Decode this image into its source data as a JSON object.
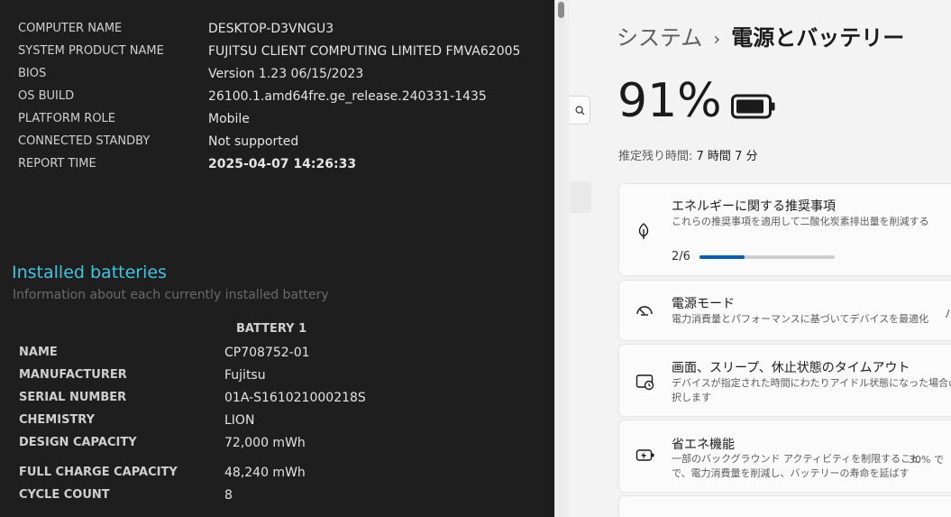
{
  "report": {
    "system_rows": [
      {
        "key": "COMPUTER NAME",
        "value": "DESKTOP-D3VNGU3"
      },
      {
        "key": "SYSTEM PRODUCT NAME",
        "value": "FUJITSU CLIENT COMPUTING LIMITED FMVA62005"
      },
      {
        "key": "BIOS",
        "value": "Version 1.23 06/15/2023"
      },
      {
        "key": "OS BUILD",
        "value": "26100.1.amd64fre.ge_release.240331-1435"
      },
      {
        "key": "PLATFORM ROLE",
        "value": "Mobile"
      },
      {
        "key": "CONNECTED STANDBY",
        "value": "Not supported"
      },
      {
        "key": "REPORT TIME",
        "value": "2025-04-07  14:26:33"
      }
    ],
    "batteries_title": "Installed batteries",
    "batteries_subtitle": "Information about each currently installed battery",
    "battery_column": "BATTERY 1",
    "battery_rows": [
      {
        "key": "NAME",
        "value": "CP708752-01"
      },
      {
        "key": "MANUFACTURER",
        "value": "Fujitsu"
      },
      {
        "key": "SERIAL NUMBER",
        "value": "01A-S161021000218S"
      },
      {
        "key": "CHEMISTRY",
        "value": "LION"
      },
      {
        "key": "DESIGN CAPACITY",
        "value": "72,000 mWh"
      },
      {
        "key": "FULL CHARGE CAPACITY",
        "value": "48,240 mWh"
      },
      {
        "key": "CYCLE COUNT",
        "value": "8"
      }
    ]
  },
  "settings": {
    "breadcrumb_parent": "システム",
    "breadcrumb_separator": "›",
    "breadcrumb_current": "電源とバッテリー",
    "battery_percent": "91%",
    "battery_level": 0.91,
    "remaining_label": "推定残り時間:",
    "remaining_value": "7 時間 7 分",
    "cards": {
      "energy": {
        "title": "エネルギーに関する推奨事項",
        "desc": "これらの推奨事項を適用して二酸化炭素排出量を削減する",
        "progress_text": "2/6",
        "progress_fraction": 0.333
      },
      "power_mode": {
        "title": "電源モード",
        "desc": "電力消費量とパフォーマンスに基づいてデバイスを最適化",
        "value_fragment": "バ"
      },
      "screen": {
        "title": "画面、スリープ、休止状態のタイムアウト",
        "desc_line1": "デバイスが指定された時間にわたりアイドル状態になった場合の動作",
        "desc_line2": "択します"
      },
      "saver": {
        "title": "省エネ機能",
        "desc_line1": "一部のバックグラウンド アクティビティを制限すること",
        "desc_line2": "で、電力消費量を削減し、バッテリーの寿命を延ばす",
        "value_fragment": "30% で"
      }
    }
  },
  "icons": {
    "search": "search-icon",
    "leaf": "leaf-icon",
    "gauge": "gauge-icon",
    "monitor_clock": "monitor-clock-icon",
    "battery_saver": "battery-saver-icon",
    "battery": "battery-icon"
  },
  "colors": {
    "report_bg": "#1e1e1e",
    "report_accent": "#3ec6e0",
    "accent": "#005fb8"
  }
}
